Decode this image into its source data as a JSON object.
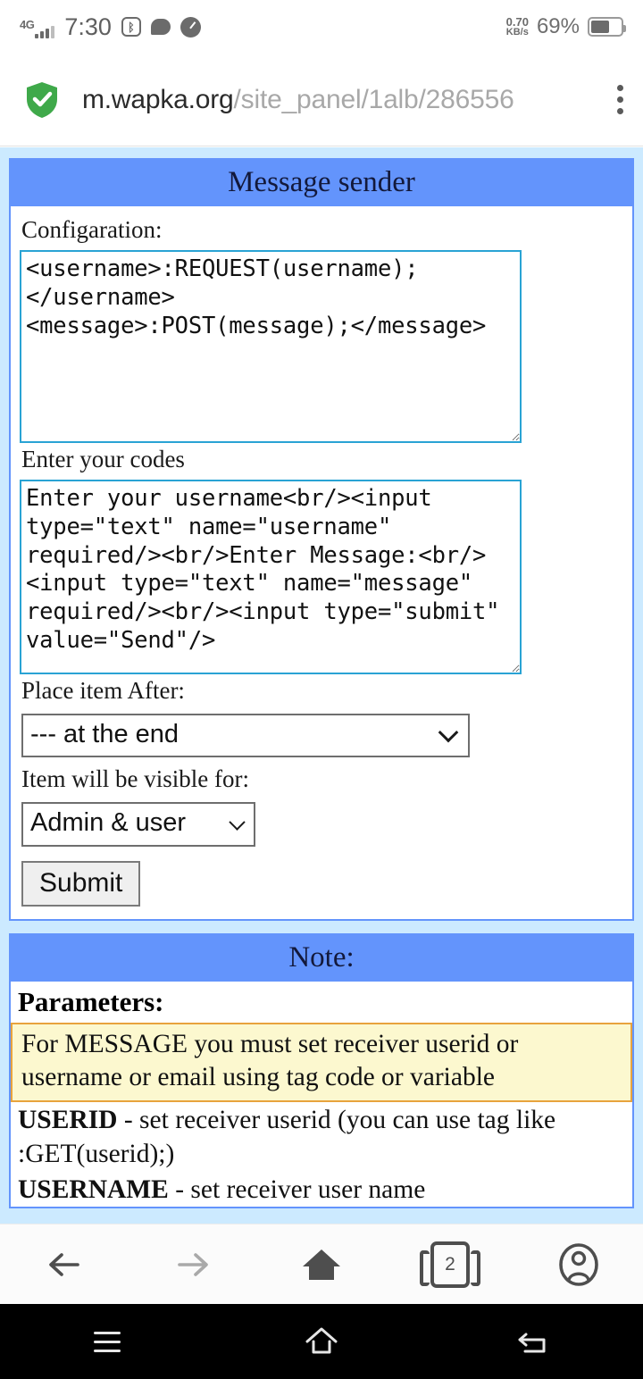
{
  "status_bar": {
    "network_type": "4G",
    "time": "7:30",
    "data_rate_value": "0.70",
    "data_rate_unit": "KB/s",
    "battery_percent": "69%",
    "icons": [
      "signal-bars-icon",
      "bluetooth-badge-icon",
      "chat-bubble-icon",
      "speedometer-icon",
      "battery-icon"
    ]
  },
  "browser": {
    "security_icon": "green-shield-check-icon",
    "url_host": "m.wapka.org",
    "url_path": "/site_panel/1alb/286556",
    "menu_icon": "overflow-menu-icon"
  },
  "card_sender": {
    "title": "Message sender",
    "config_label": "Configaration:",
    "config_value": "<username>:REQUEST(username);\n</username>\n<message>:POST(message);</message>",
    "codes_label": "Enter your codes",
    "codes_value": "Enter your username<br/><input type=\"text\" name=\"username\" required/><br/>Enter Message:<br/><input type=\"text\" name=\"message\" required/><br/><input type=\"submit\" value=\"Send\"/>",
    "place_label": "Place item After:",
    "place_value": "--- at the end",
    "place_options": [
      "--- at the end"
    ],
    "visible_label": "Item will be visible for:",
    "visible_value": "Admin & user",
    "visible_options": [
      "Admin & user"
    ],
    "submit_label": "Submit"
  },
  "card_note": {
    "title": "Note:",
    "parameters_heading": "Parameters:",
    "highlight": "For MESSAGE you must set receiver userid or username or email using tag code or variable",
    "lines": [
      {
        "term": "USERID",
        "rest": " - set receiver userid (you can use tag like :GET(userid);)"
      },
      {
        "term": "USERNAME",
        "rest": " - set receiver user name"
      }
    ]
  },
  "browser_nav": {
    "items": [
      "back-arrow-icon",
      "forward-arrow-icon",
      "home-icon",
      "tabs-icon",
      "account-icon"
    ],
    "tab_count": "2"
  },
  "system_nav": {
    "items": [
      "recents-icon",
      "home-icon",
      "back-icon"
    ]
  },
  "colors": {
    "page_background": "#cceaff",
    "card_header_blue": "#6394fc",
    "textarea_border": "#29a3d4",
    "note_highlight_bg": "#fcf8cf",
    "note_highlight_border": "#e8a33d",
    "shield_green": "#3fa94a"
  }
}
